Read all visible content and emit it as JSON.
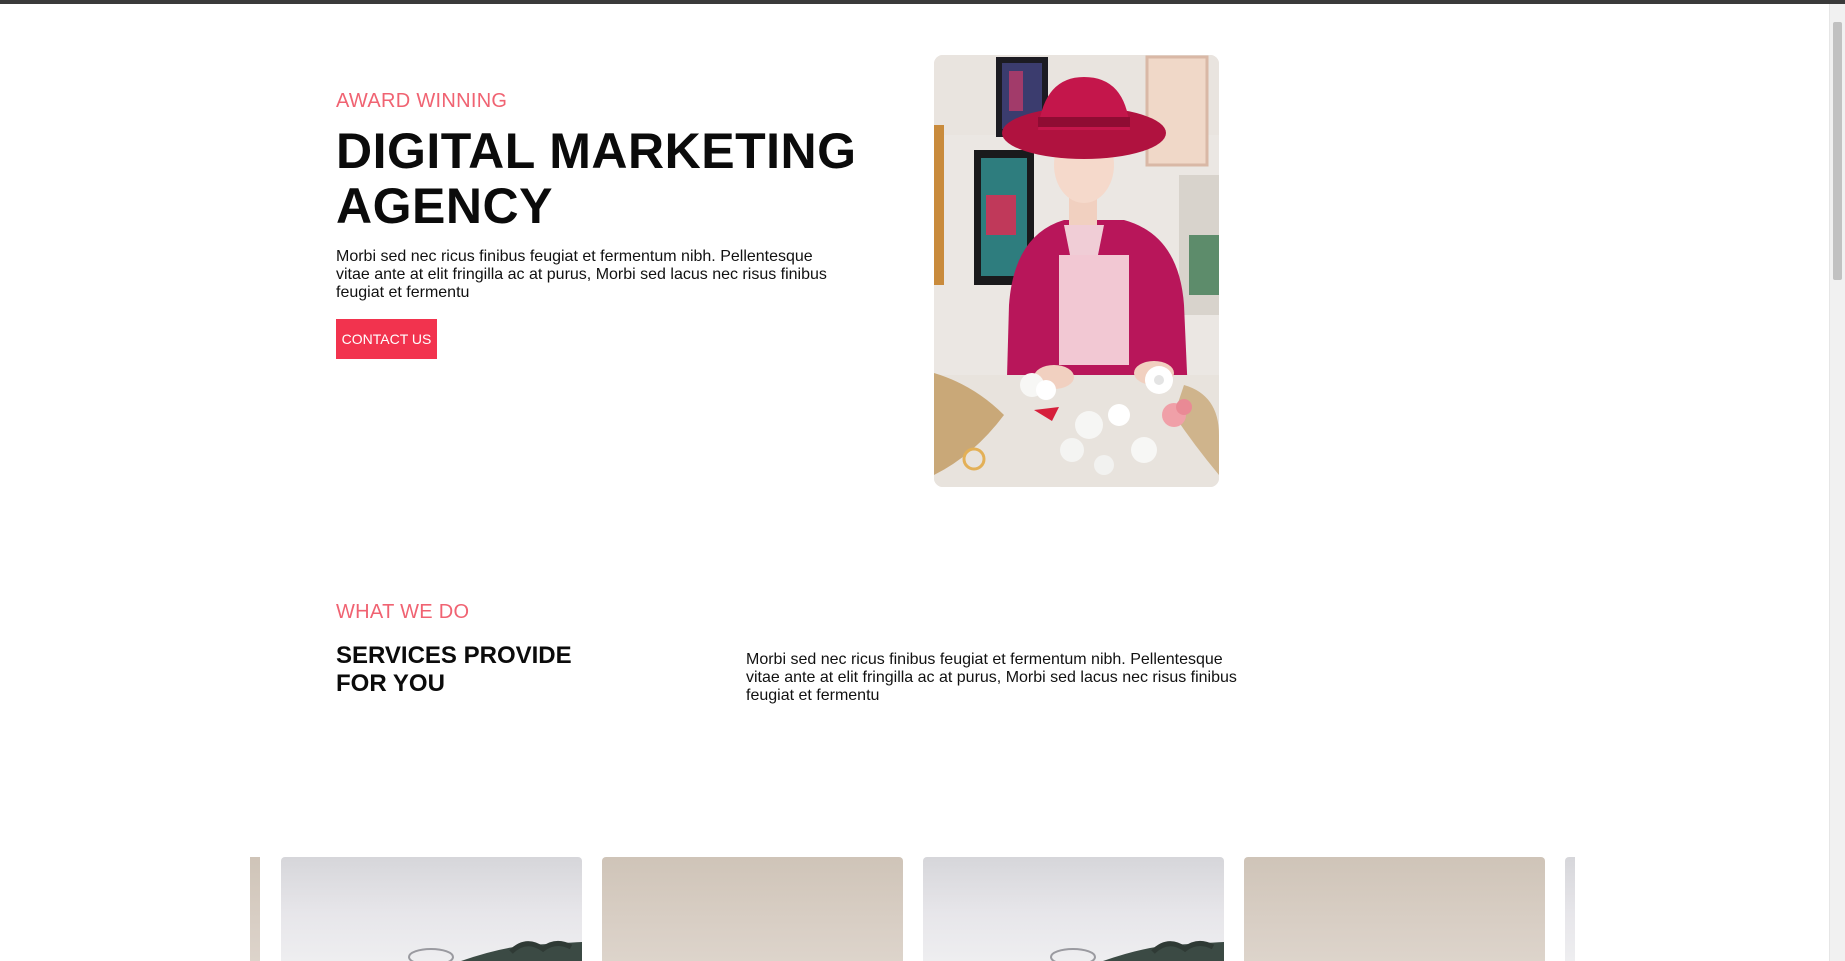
{
  "hero": {
    "eyebrow": "AWARD WINNING",
    "title_line1": "DIGITAL MARKETING",
    "title_line2": "AGENCY",
    "body": "Morbi sed nec ricus finibus feugiat et fermentum nibh. Pellentesque vitae ante at elit fringilla ac at purus, Morbi sed lacus nec risus finibus feugiat et fermentu",
    "cta_label": "CONTACT US",
    "image_icon": "woman-crafting-photo"
  },
  "services": {
    "eyebrow": "WHAT WE DO",
    "title_line1": "SERVICES PROVIDE",
    "title_line2": "FOR YOU",
    "body": "Morbi sed nec ricus finibus feugiat et fermentum nibh. Pellentesque vitae ante at elit fringilla ac at purus, Morbi sed lacus nec risus finibus feugiat et fermentu"
  },
  "colors": {
    "accent": "#f06372",
    "button": "#f2334e",
    "heading": "#0b0b0b"
  }
}
